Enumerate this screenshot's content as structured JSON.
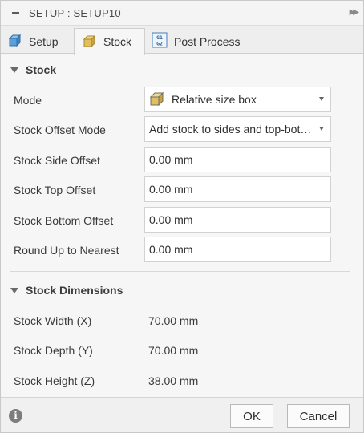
{
  "window": {
    "title": "SETUP : SETUP10"
  },
  "tabs": [
    {
      "label": "Setup",
      "icon": "setup-icon",
      "active": false
    },
    {
      "label": "Stock",
      "icon": "stock-box-icon",
      "active": true
    },
    {
      "label": "Post Process",
      "icon": "g1-g2-icon",
      "active": false
    }
  ],
  "stock_section": {
    "title": "Stock",
    "mode": {
      "label": "Mode",
      "value": "Relative size box"
    },
    "offset_mode": {
      "label": "Stock Offset Mode",
      "value": "Add stock to sides and top-bottom"
    },
    "side_offset": {
      "label": "Stock Side Offset",
      "value": "0.00 mm"
    },
    "top_offset": {
      "label": "Stock Top Offset",
      "value": "0.00 mm"
    },
    "bottom_offset": {
      "label": "Stock Bottom Offset",
      "value": "0.00 mm"
    },
    "round_up": {
      "label": "Round Up to Nearest",
      "value": "0.00 mm"
    }
  },
  "dimensions_section": {
    "title": "Stock Dimensions",
    "width": {
      "label": "Stock Width (X)",
      "value": "70.00 mm"
    },
    "depth": {
      "label": "Stock Depth (Y)",
      "value": "70.00 mm"
    },
    "height": {
      "label": "Stock Height (Z)",
      "value": "38.00 mm"
    }
  },
  "footer": {
    "ok_label": "OK",
    "cancel_label": "Cancel",
    "info_icon": "info-icon"
  },
  "colors": {
    "accent_box": "#d9b24a",
    "setup_icon": "#3b82c4"
  }
}
